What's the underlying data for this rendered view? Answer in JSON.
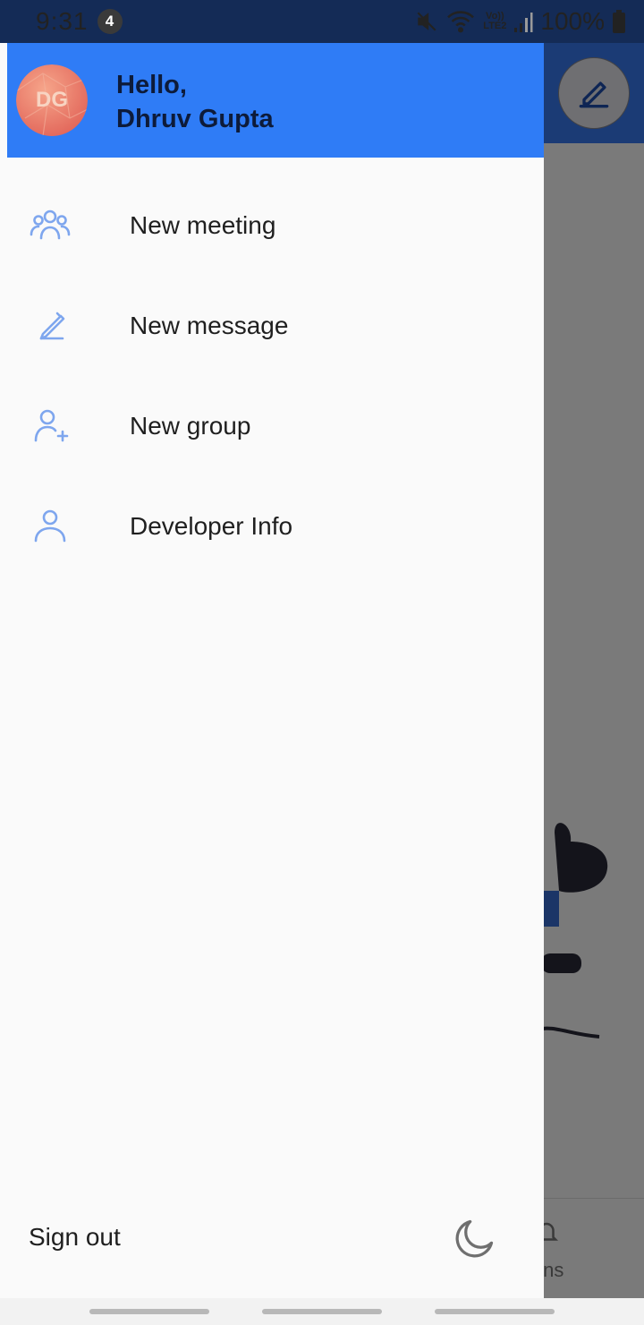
{
  "status_bar": {
    "time": "9:31",
    "notification_count": "4",
    "network_top": "Vo))",
    "network_bottom": "LTE2",
    "battery": "100%"
  },
  "drawer": {
    "avatar_initials": "DG",
    "greeting_line1": "Hello,",
    "greeting_line2": "Dhruv Gupta",
    "items": [
      {
        "label": "New meeting",
        "icon": "group-icon"
      },
      {
        "label": "New message",
        "icon": "pencil-icon"
      },
      {
        "label": "New group",
        "icon": "add-person-icon"
      },
      {
        "label": "Developer Info",
        "icon": "person-icon"
      }
    ],
    "sign_out_label": "Sign out",
    "theme_toggle_icon": "moon-icon"
  },
  "background": {
    "bottom_nav_partial_label": "ions"
  },
  "colors": {
    "header_blue": "#2f7cf6",
    "icon_blue": "#7ea6ee",
    "text_dark": "#1f1f1f"
  }
}
